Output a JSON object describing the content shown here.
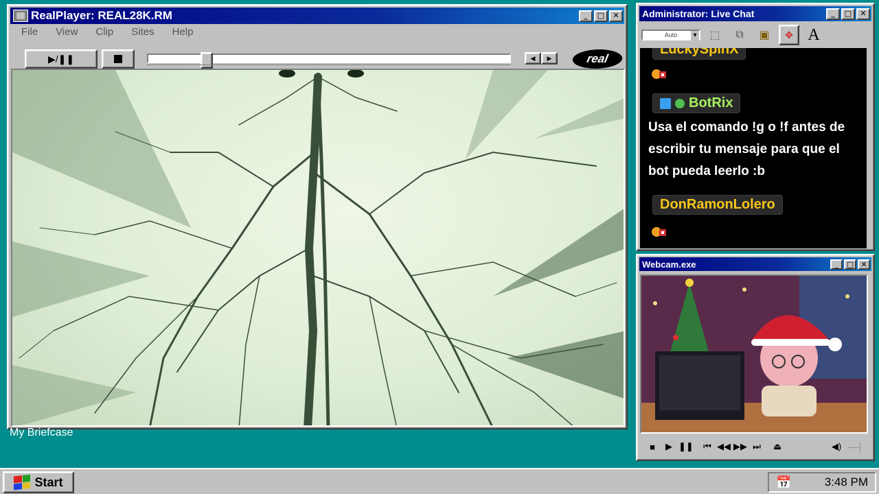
{
  "realplayer": {
    "title": "RealPlayer: REAL28K.RM",
    "menu": [
      "File",
      "View",
      "Clip",
      "Sites",
      "Help"
    ],
    "play_label": "▶/❚❚",
    "logo_text": "real",
    "progress": 0.15
  },
  "chat": {
    "title": "Administrator: Live Chat",
    "size_select": "Auto",
    "font_tool": "A",
    "users": {
      "top_partial": "LuckySpinX",
      "bot": "BotRix",
      "third": "DonRamonLolero"
    },
    "bot_message": "Usa el comando !g o !f antes de escribir tu mensaje para que el bot pueda leerlo :b",
    "colors": {
      "username": "#f5c518",
      "bot_name": "#a8f060",
      "bot_icon": "#3aa0f0"
    }
  },
  "webcam": {
    "title": "Webcam.exe"
  },
  "desktop": {
    "briefcase_label": "My Briefcase"
  },
  "taskbar": {
    "start_label": "Start",
    "clock": "3:48 PM"
  }
}
